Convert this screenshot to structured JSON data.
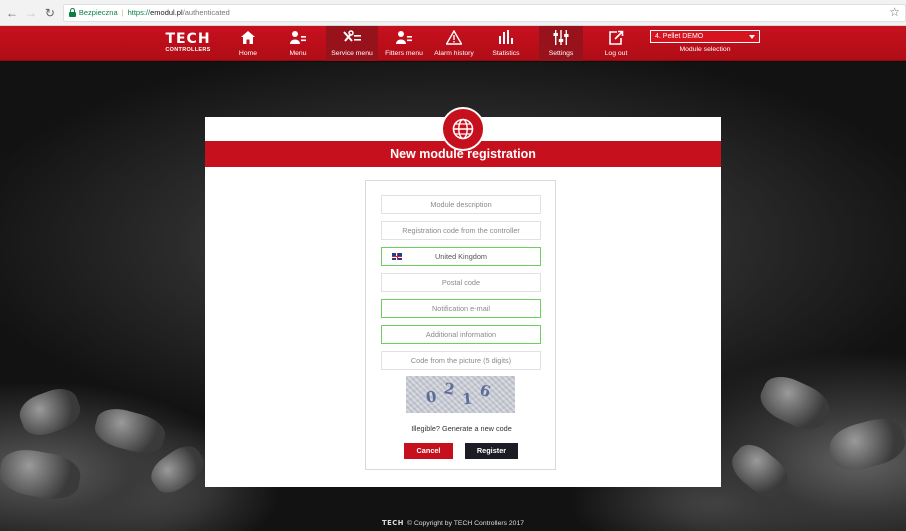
{
  "browser": {
    "back_icon": "arrow-left-icon",
    "forward_icon": "arrow-right-icon",
    "reload_icon": "reload-icon",
    "secure_label": "Bezpieczna",
    "url_scheme": "https://",
    "url_host": "emodul.pl",
    "url_path": "/authenticated",
    "bookmark_icon": "star-icon"
  },
  "header": {
    "logo_main": "TECH",
    "logo_sub": "CONTROLLERS",
    "menu": [
      {
        "label": "Home",
        "icon": "home-icon"
      },
      {
        "label": "Menu",
        "icon": "user-menu-icon"
      },
      {
        "label": "Service menu",
        "icon": "tools-icon",
        "active": true
      },
      {
        "label": "Fitters menu",
        "icon": "user-menu-icon"
      },
      {
        "label": "Alarm history",
        "icon": "warning-icon"
      },
      {
        "label": "Statistics",
        "icon": "bar-chart-icon"
      },
      {
        "label": "Settings",
        "icon": "sliders-icon",
        "active": true
      },
      {
        "label": "Log out",
        "icon": "logout-icon"
      }
    ],
    "module_select_value": "4. Pellet DEMO",
    "module_select_caption": "Module selection"
  },
  "modal": {
    "icon": "globe-icon",
    "title": "New module registration",
    "fields": {
      "module_description": "Module description",
      "registration_code": "Registration code from the controller",
      "country": "United Kingdom",
      "postal_code": "Postal code",
      "notification_email": "Notification e-mail",
      "additional_info": "Additional information",
      "captcha_input": "Code from the picture (5 digits)"
    },
    "captcha_chars": [
      "0",
      "2",
      "1",
      "6"
    ],
    "regen_link": "Illegible? Generate a new code",
    "cancel_label": "Cancel",
    "register_label": "Register"
  },
  "footer": {
    "logo": "TECH",
    "text": "© Copyright by TECH Controllers 2017"
  },
  "colors": {
    "brand_red": "#c7101d",
    "dark_button": "#1c1c26",
    "valid_border": "#6ccf5f"
  }
}
